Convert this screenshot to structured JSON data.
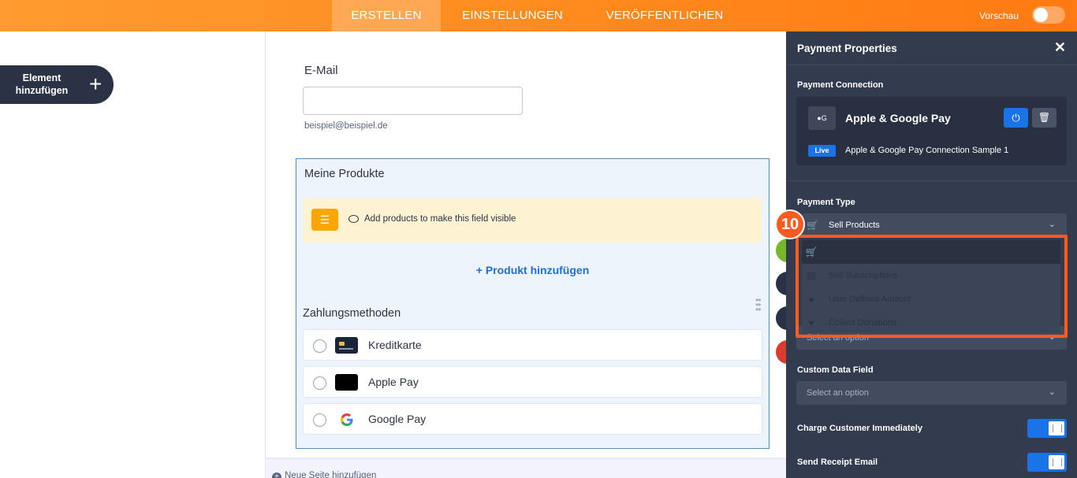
{
  "topbar": {
    "tabs": [
      "ERSTELLEN",
      "EINSTELLUNGEN",
      "VERÖFFENTLICHEN"
    ],
    "preview_label": "Vorschau"
  },
  "left": {
    "add_element_label": "Element hinzufügen",
    "add_element_plus": "+"
  },
  "form": {
    "email_label": "E-Mail",
    "email_value": "",
    "email_sublabel": "beispiel@beispiel.de",
    "products_title": "Meine Produkte",
    "notice_text": "Add products to make this field visible",
    "add_product_label": "+ Produkt hinzufügen",
    "payment_methods_title": "Zahlungsmethoden",
    "payment_methods": [
      {
        "label": "Kreditkarte",
        "icon": "credit-card-icon"
      },
      {
        "label": "Apple Pay",
        "icon": "apple-icon"
      },
      {
        "label": "Google Pay",
        "icon": "google-icon"
      }
    ],
    "new_page_label": "Neue Seite hinzufügen"
  },
  "panel": {
    "title": "Payment Properties",
    "close": "✕",
    "connection_label": "Payment Connection",
    "connection_name": "Apple & Google Pay",
    "connection_logo": "●G",
    "live_badge": "Live",
    "connection_sample": "Apple & Google Pay Connection Sample 1",
    "payment_type_label": "Payment Type",
    "payment_type_value": "Sell Products",
    "dropdown_options": [
      "Sell Products",
      "Sell Subscriptions",
      "User Defined Amount",
      "Collect Donations"
    ],
    "hidden_select_placeholder": "Select an option",
    "custom_data_label": "Custom Data Field",
    "custom_data_placeholder": "Select an option",
    "charge_label": "Charge Customer Immediately",
    "receipt_label": "Send Receipt Email"
  },
  "annotation": {
    "step_number": "10",
    "highlight_color": "#ff5a1f"
  },
  "colors": {
    "accent": "#ff8a1d",
    "panel_bg": "#333b4e",
    "primary_blue": "#1a73e8"
  }
}
